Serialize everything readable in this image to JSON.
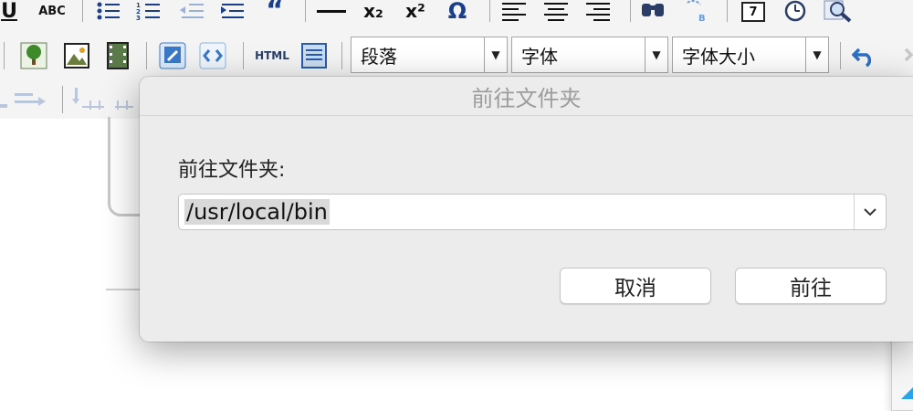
{
  "toolbar": {
    "row1_icons": [
      "underline-icon",
      "spellcheck-icon",
      "bullet-list-icon",
      "numbered-list-icon",
      "outdent-icon",
      "indent-icon",
      "blockquote-icon",
      "horizontal-rule-icon",
      "subscript-icon",
      "superscript-icon",
      "special-char-icon",
      "align-left-icon",
      "align-center-icon",
      "align-right-icon",
      "find-icon",
      "replace-icon",
      "date-icon",
      "time-icon",
      "preview-icon"
    ],
    "underline_glyph": "U",
    "spell_glyph": "ABC",
    "quote_glyph": "“",
    "subscript_glyph": "x₂",
    "superscript_glyph": "x²",
    "omega_glyph": "Ω",
    "date_glyph": "7",
    "html_label": "HTML",
    "paragraph_label": "段落",
    "font_label": "字体",
    "font_size_label": "字体大小"
  },
  "dialog": {
    "title": "前往文件夹",
    "field_label": "前往文件夹:",
    "path_value": "/usr/local/bin",
    "cancel_label": "取消",
    "go_label": "前往"
  },
  "colors": {
    "icon_blue": "#1b3e8a",
    "dialog_bg": "#ececec",
    "selection_gray": "#d9d9d9",
    "accent_cyan": "#2aa4e8"
  }
}
